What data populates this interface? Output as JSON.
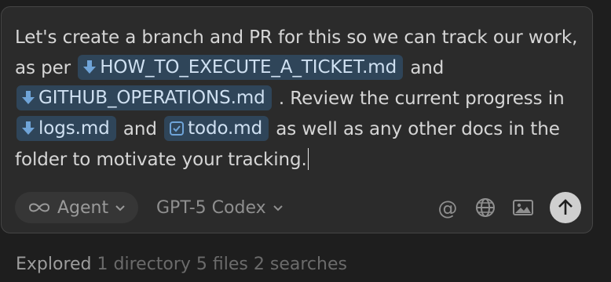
{
  "prompt": {
    "t1": "Let's create a branch and PR for this so we can track our work, as per",
    "chip1": "HOW_TO_EXECUTE_A_TICKET.md",
    "t2": "and",
    "chip2": "GITHUB_OPERATIONS.md",
    "t3": ". Review the current progress in",
    "chip3": "logs.md",
    "t4": "and",
    "chip4": "todo.md",
    "t5": "as well as any other docs in the folder to motivate your tracking."
  },
  "toolbar": {
    "mode_label": "Agent",
    "model_label": "GPT-5 Codex"
  },
  "icons": {
    "mode": "infinity-icon",
    "mention": "at-icon",
    "web": "globe-icon",
    "image": "image-icon",
    "send": "arrow-up-icon",
    "file_markdown": "download-arrow-icon",
    "file_checklist": "checkbox-icon"
  },
  "status": {
    "verb": "Explored",
    "details": "1 directory 5 files 2 searches"
  },
  "colors": {
    "background": "#1e1e1e",
    "composer": "#2b2b2b",
    "chip": "#2f4559",
    "chip_icon": "#6fa4d8"
  }
}
